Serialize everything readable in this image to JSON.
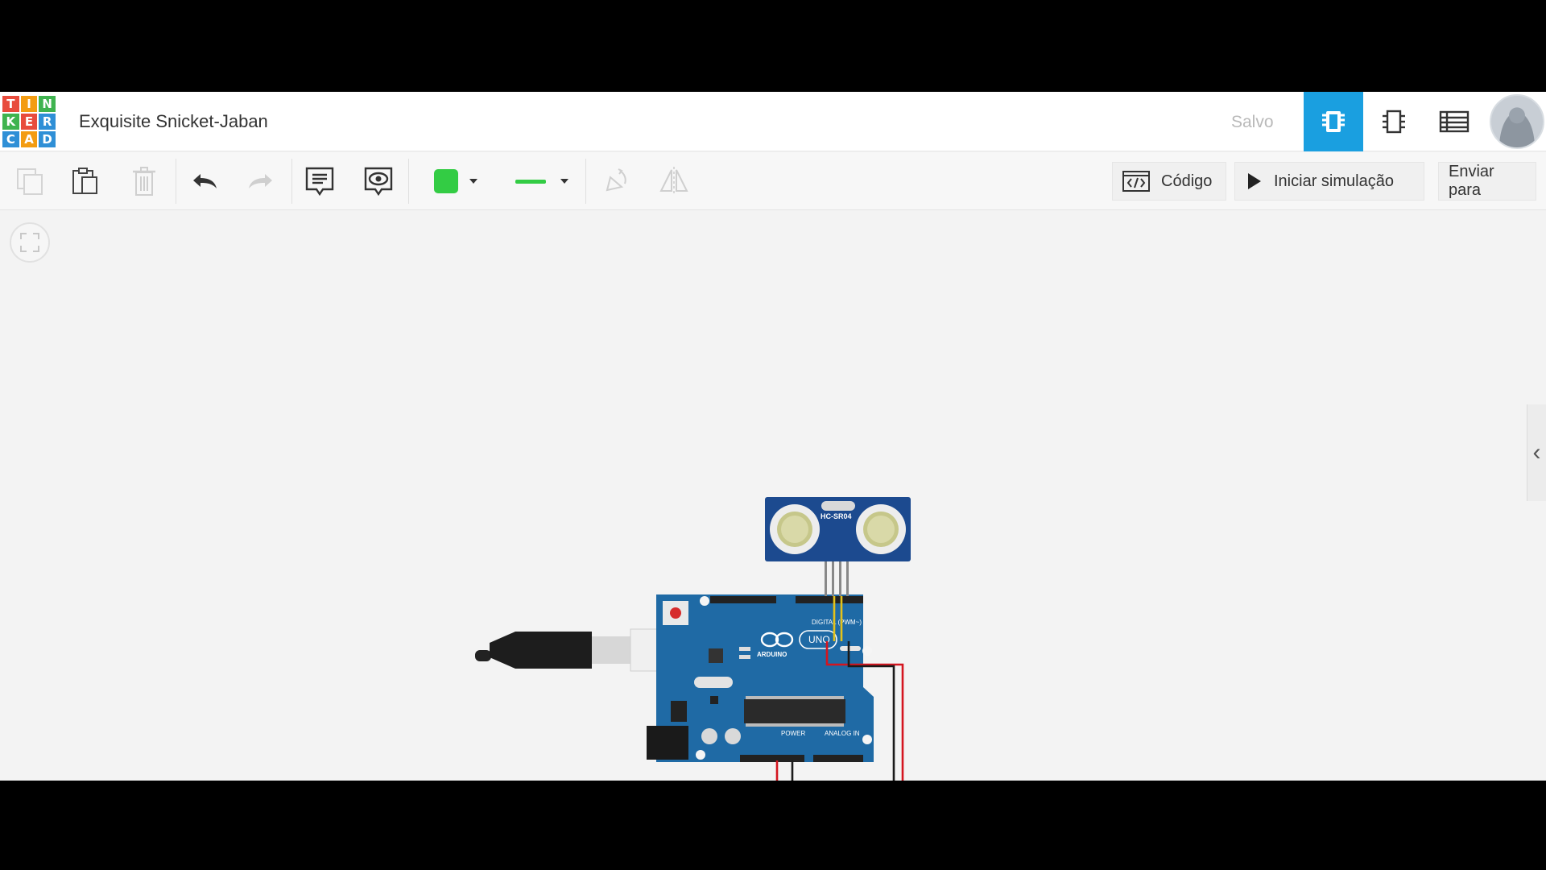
{
  "app": {
    "logo_letters": [
      "T",
      "I",
      "N",
      "K",
      "E",
      "R",
      "C",
      "A",
      "D"
    ],
    "logo_colors": [
      "#e84c3d",
      "#f39c12",
      "#3fb34f",
      "#3fb34f",
      "#e84c3d",
      "#2f8fd6",
      "#2f8fd6",
      "#f39c12",
      "#2f8fd6"
    ],
    "project_title": "Exquisite Snicket-Jaban",
    "save_status": "Salvo",
    "accent_color": "#1a9fe0"
  },
  "header": {
    "views": [
      {
        "name": "circuit-view",
        "icon": "breadboard-icon",
        "active": true
      },
      {
        "name": "schematic-view",
        "icon": "schematic-icon",
        "active": false
      },
      {
        "name": "component-list-view",
        "icon": "list-icon",
        "active": false
      }
    ]
  },
  "toolbar": {
    "left_tools": [
      "copy-icon",
      "paste-icon",
      "delete-icon",
      "undo-icon",
      "redo-icon",
      "note-icon",
      "notes-visibility-icon",
      "color-swatch",
      "wire-style",
      "rotate-icon",
      "flip-icon"
    ],
    "wire_color": "#33cc44",
    "code_label": "Código",
    "simulate_label": "Iniciar simulação",
    "send_label": "Enviar para"
  },
  "canvas": {
    "sensor_label": "HC-SR04",
    "board_brand": "ARDUINO",
    "board_model": "UNO",
    "digital_label": "DIGITAL (PWM~)",
    "power_label": "POWER",
    "analog_label": "ANALOG IN",
    "sensor_color": "#1c4a8f",
    "board_color": "#1f6aa5",
    "wire_colors": [
      "#d4151f",
      "#1a1a1a",
      "#e3c21a"
    ]
  }
}
